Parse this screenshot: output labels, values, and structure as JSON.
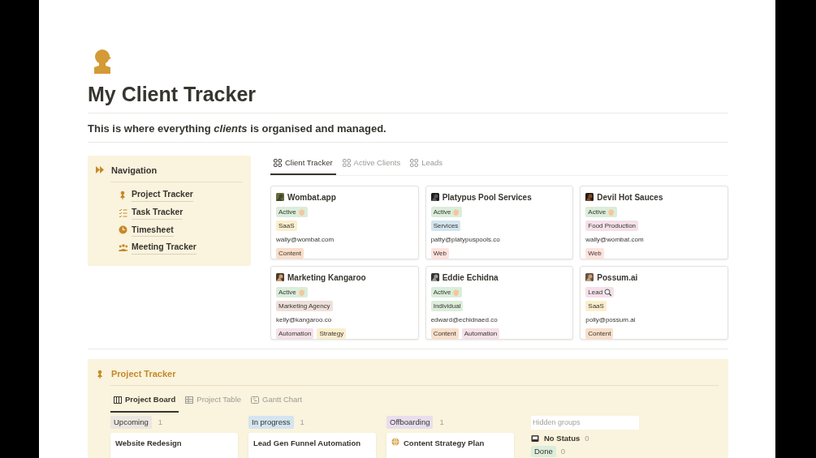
{
  "page": {
    "title": "My Client Tracker",
    "description": "This is where everything *clients* is organised and managed."
  },
  "navigation": {
    "title": "Navigation",
    "items": [
      {
        "label": "Project Tracker",
        "kind": "project"
      },
      {
        "label": "Task Tracker",
        "kind": "task"
      },
      {
        "label": "Timesheet",
        "kind": "time"
      },
      {
        "label": "Meeting Tracker",
        "kind": "meeting"
      }
    ]
  },
  "client_views": {
    "tabs": [
      {
        "label": "Client Tracker",
        "selected": true
      },
      {
        "label": "Active Clients",
        "selected": false
      },
      {
        "label": "Leads",
        "selected": false
      }
    ],
    "cards": [
      {
        "name": "Wombat.app",
        "status": {
          "label": "Active",
          "kind": "active",
          "color": "#dbeddb"
        },
        "category": {
          "label": "SaaS",
          "color": "#fbeecc"
        },
        "email": "wally@wombat.com",
        "services": [
          {
            "label": "Content",
            "color": "#fadec9"
          }
        ]
      },
      {
        "name": "Platypus Pool Services",
        "status": {
          "label": "Active",
          "kind": "active",
          "color": "#dbeddb"
        },
        "category": {
          "label": "Services",
          "color": "#d3e5ef"
        },
        "email": "patty@platypuspools.co",
        "services": [
          {
            "label": "Web",
            "color": "#ffe2dd"
          }
        ]
      },
      {
        "name": "Devil Hot Sauces",
        "status": {
          "label": "Active",
          "kind": "active",
          "color": "#dbeddb"
        },
        "category": {
          "label": "Food Production",
          "color": "#f5e0e9"
        },
        "email": "wally@wombat.com",
        "services": [
          {
            "label": "Web",
            "color": "#ffe2dd"
          }
        ]
      },
      {
        "name": "Marketing Kangaroo",
        "status": {
          "label": "Active",
          "kind": "active",
          "color": "#dbeddb"
        },
        "category": {
          "label": "Marketing Agency",
          "color": "#eee0da"
        },
        "email": "kelly@kangaroo.co",
        "services": [
          {
            "label": "Automation",
            "color": "#f5e0e9"
          },
          {
            "label": "Strategy",
            "color": "#fbeecc"
          }
        ]
      },
      {
        "name": "Eddie Echidna",
        "status": {
          "label": "Active",
          "kind": "active",
          "color": "#dbeddb"
        },
        "category": {
          "label": "Individual",
          "color": "#dbeddb"
        },
        "email": "edward@echidnaed.co",
        "services": [
          {
            "label": "Content",
            "color": "#fadec9"
          },
          {
            "label": "Automation",
            "color": "#f5e0e9"
          }
        ]
      },
      {
        "name": "Possum.ai",
        "status": {
          "label": "Lead",
          "kind": "lead",
          "color": "#f5e0e9"
        },
        "category": {
          "label": "SaaS",
          "color": "#fbeecc"
        },
        "email": "polly@possum.ai",
        "services": [
          {
            "label": "Content",
            "color": "#fadec9"
          }
        ]
      }
    ]
  },
  "project_tracker": {
    "title": "Project Tracker",
    "tabs": [
      {
        "label": "Project Board",
        "kind": "board",
        "selected": true
      },
      {
        "label": "Project Table",
        "kind": "table",
        "selected": false
      },
      {
        "label": "Gantt Chart",
        "kind": "gantt",
        "selected": false
      }
    ],
    "groups": [
      {
        "label": "Upcoming",
        "count": "1",
        "color": "#ebe6df",
        "cards": [
          {
            "title": "Website Redesign",
            "kind": "plain"
          }
        ]
      },
      {
        "label": "In progress",
        "count": "1",
        "color": "#d3e5ef",
        "cards": [
          {
            "title": "Lead Gen Funnel Automation",
            "kind": "plain"
          }
        ]
      },
      {
        "label": "Offboarding",
        "count": "1",
        "color": "#e8deee",
        "cards": [
          {
            "title": "Content Strategy Plan",
            "kind": "web"
          }
        ]
      }
    ],
    "hidden_groups": {
      "title": "Hidden groups",
      "items": [
        {
          "label": "No Status",
          "count": "0",
          "kind": "none"
        },
        {
          "label": "Done",
          "count": "0",
          "kind": "done",
          "color": "#dbeddb"
        }
      ]
    }
  }
}
